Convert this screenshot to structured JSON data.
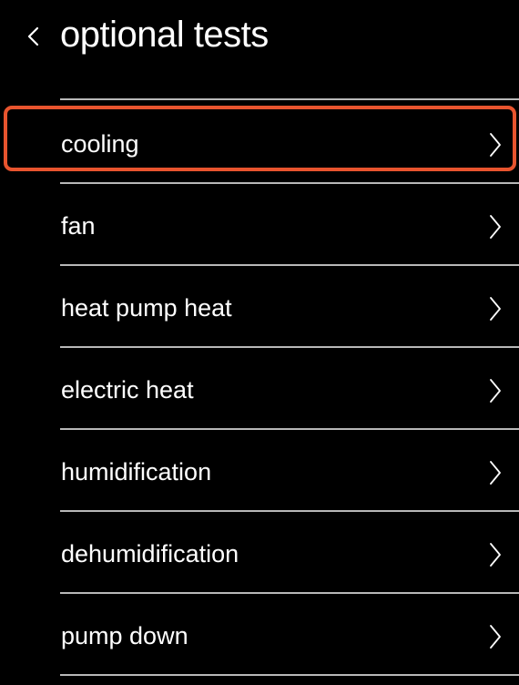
{
  "header": {
    "title": "optional tests",
    "back_icon": "chevron-left-icon"
  },
  "tests": {
    "items": [
      {
        "label": "cooling",
        "selected": true
      },
      {
        "label": "fan",
        "selected": false
      },
      {
        "label": "heat pump heat",
        "selected": false
      },
      {
        "label": "electric heat",
        "selected": false
      },
      {
        "label": "humidification",
        "selected": false
      },
      {
        "label": "dehumidification",
        "selected": false
      },
      {
        "label": "pump down",
        "selected": false
      }
    ],
    "row_icon": "chevron-right-icon"
  },
  "colors": {
    "background": "#000000",
    "text": "#ffffff",
    "divider": "#b8b8b8",
    "highlight": "#e8542e"
  }
}
